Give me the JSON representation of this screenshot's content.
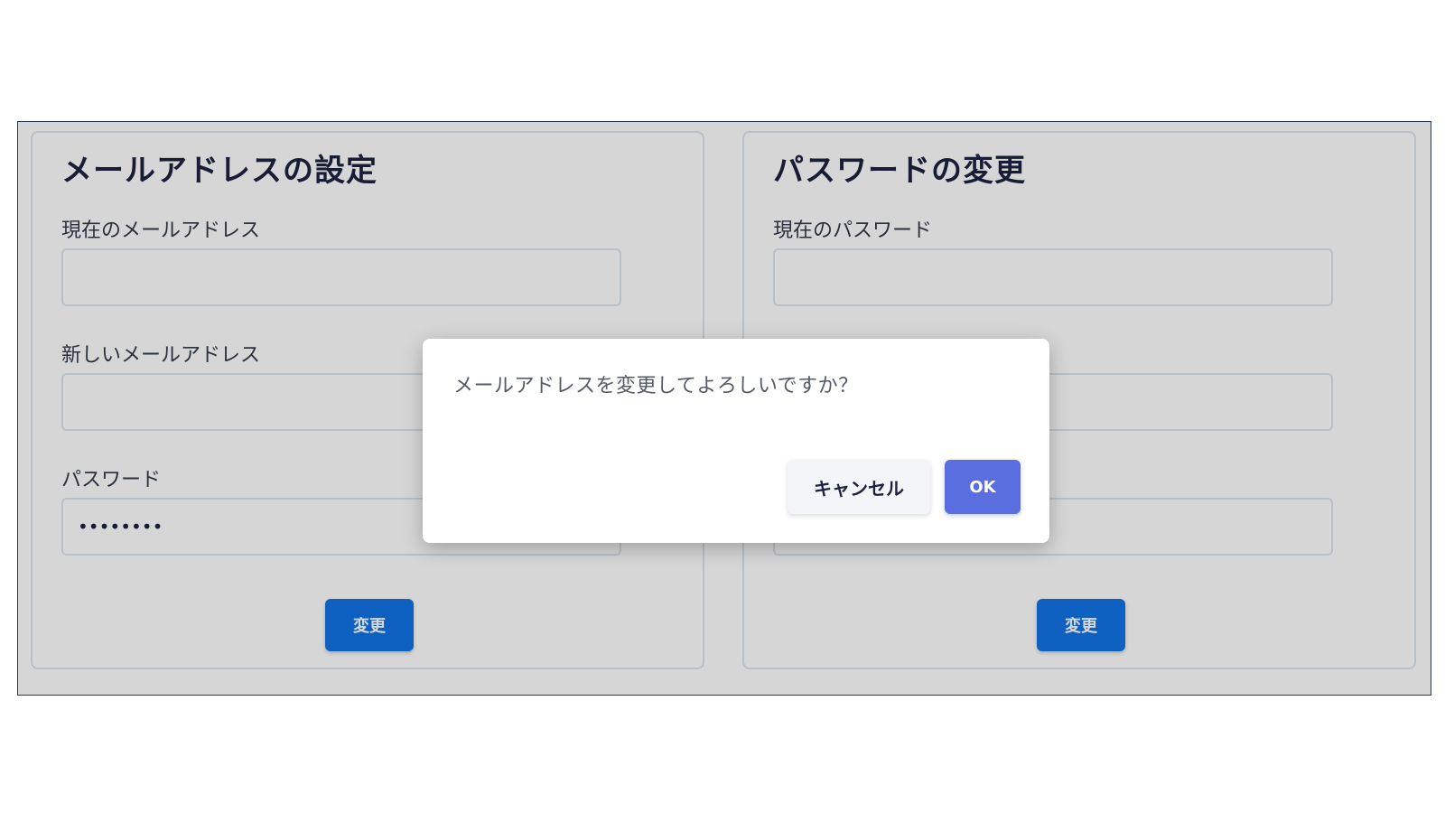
{
  "email_card": {
    "title": "メールアドレスの設定",
    "current_email": {
      "label": "現在のメールアドレス",
      "value": ""
    },
    "new_email": {
      "label": "新しいメールアドレス",
      "value": ""
    },
    "password": {
      "label": "パスワード",
      "value": "••••••••"
    },
    "submit_label": "変更"
  },
  "password_card": {
    "title": "パスワードの変更",
    "current_password": {
      "label": "現在のパスワード",
      "value": ""
    },
    "submit_label": "変更"
  },
  "dialog": {
    "message": "メールアドレスを変更してよろしいですか？",
    "cancel_label": "キャンセル",
    "ok_label": "OK"
  },
  "colors": {
    "primary_button": "#1274e6",
    "ok_button": "#5a6ee0",
    "title_text": "#1e2240"
  }
}
